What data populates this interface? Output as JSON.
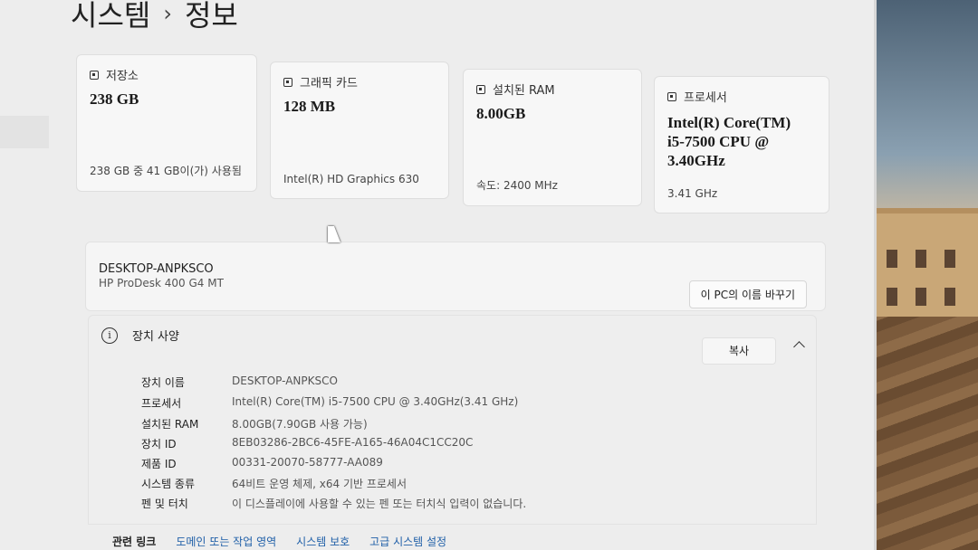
{
  "breadcrumb": {
    "parent": "시스템",
    "separator": "›",
    "current": "정보"
  },
  "cards": [
    {
      "title": "저장소",
      "value": "238 GB",
      "sub": "238 GB 중 41 GB이(가) 사용됨",
      "icon": "storage-icon"
    },
    {
      "title": "그래픽 카드",
      "value": "128 MB",
      "sub": "Intel(R) HD Graphics 630",
      "icon": "graphics-card-icon"
    },
    {
      "title": "설치된 RAM",
      "value": "8.00GB",
      "sub": "속도: 2400 MHz",
      "icon": "ram-icon"
    },
    {
      "title": "프로세서",
      "value_lines": [
        "Intel(R) Core(TM)",
        "i5-7500 CPU @",
        "3.40GHz"
      ],
      "sub": "3.41 GHz",
      "icon": "processor-icon"
    }
  ],
  "device": {
    "name": "DESKTOP-ANPKSCO",
    "model": "HP ProDesk 400 G4 MT",
    "rename_label": "이 PC의 이름 바꾸기"
  },
  "specs": {
    "title": "장치 사양",
    "copy_label": "복사",
    "rows": [
      {
        "key": "장치 이름",
        "value": "DESKTOP-ANPKSCO"
      },
      {
        "key": "프로세서",
        "value": "Intel(R) Core(TM) i5-7500 CPU @ 3.40GHz(3.41 GHz)"
      },
      {
        "key": "설치된 RAM",
        "value": "8.00GB(7.90GB 사용 가능)"
      },
      {
        "key": "장치 ID",
        "value": "8EB03286-2BC6-45FE-A165-46A04C1CC20C"
      },
      {
        "key": "제품 ID",
        "value": "00331-20070-58777-AA089"
      },
      {
        "key": "시스템 종류",
        "value": "64비트 운영 체제, x64 기반 프로세서"
      },
      {
        "key": "펜 및 터치",
        "value": "이 디스플레이에 사용할 수 있는 펜 또는 터치식 입력이 없습니다."
      }
    ]
  },
  "related": {
    "label": "관련 링크",
    "links": [
      "도메인 또는 작업 영역",
      "시스템 보호",
      "고급 시스템 설정"
    ]
  }
}
